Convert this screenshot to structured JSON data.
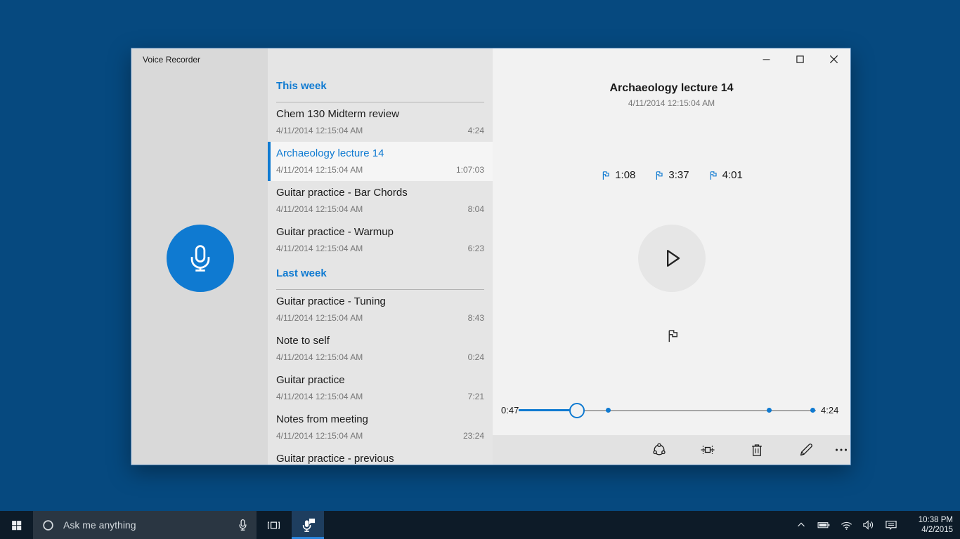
{
  "colors": {
    "accent": "#0f7ad1",
    "desktop": "#06497f",
    "taskbar": "#0d1b28",
    "taskbar_search": "#2a3642",
    "app_button_bg": "#1e3e5f",
    "app_button_underline": "#2a85dc",
    "toolbar_bg": "#e2e2e2"
  },
  "window": {
    "title": "Voice Recorder",
    "control_icons": [
      "minimize-icon",
      "maximize-icon",
      "close-icon"
    ]
  },
  "recordings": {
    "sections": [
      {
        "label": "This week",
        "items": [
          {
            "title": "Chem 130 Midterm review",
            "date": "4/11/2014 12:15:04 AM",
            "duration": "4:24",
            "selected": false
          },
          {
            "title": "Archaeology lecture 14",
            "date": "4/11/2014 12:15:04 AM",
            "duration": "1:07:03",
            "selected": true
          },
          {
            "title": "Guitar practice - Bar Chords",
            "date": "4/11/2014 12:15:04 AM",
            "duration": "8:04",
            "selected": false
          },
          {
            "title": "Guitar practice - Warmup",
            "date": "4/11/2014 12:15:04 AM",
            "duration": "6:23",
            "selected": false
          }
        ]
      },
      {
        "label": "Last week",
        "items": [
          {
            "title": "Guitar practice - Tuning",
            "date": "4/11/2014 12:15:04 AM",
            "duration": "8:43",
            "selected": false
          },
          {
            "title": "Note to self",
            "date": "4/11/2014 12:15:04 AM",
            "duration": "0:24",
            "selected": false
          },
          {
            "title": "Guitar practice",
            "date": "4/11/2014 12:15:04 AM",
            "duration": "7:21",
            "selected": false
          },
          {
            "title": "Notes from meeting",
            "date": "4/11/2014 12:15:04 AM",
            "duration": "23:24",
            "selected": false
          },
          {
            "title": "Guitar practice - previous",
            "date": "",
            "duration": "",
            "selected": false
          }
        ]
      }
    ]
  },
  "player": {
    "title": "Archaeology lecture 14",
    "date": "4/11/2014 12:15:04 AM",
    "current_time": "0:47",
    "total_time": "4:24",
    "progress_percent": 19.6,
    "markers": [
      {
        "label": "1:08",
        "percent": 30.0
      },
      {
        "label": "3:37",
        "percent": 84.2
      },
      {
        "label": "4:01",
        "percent": 98.8
      }
    ],
    "toolbar_icons": [
      "share-icon",
      "trim-icon",
      "delete-icon",
      "rename-icon",
      "more-icon"
    ]
  },
  "taskbar": {
    "search_placeholder": "Ask me anything",
    "icons": [
      "start-icon",
      "cortana-icon",
      "mic-icon",
      "task-view-icon",
      "voice-recorder-app-icon",
      "chevron-up-icon",
      "battery-icon",
      "wifi-icon",
      "volume-icon",
      "action-center-icon"
    ],
    "clock": {
      "time": "10:38 PM",
      "date": "4/2/2015"
    }
  }
}
